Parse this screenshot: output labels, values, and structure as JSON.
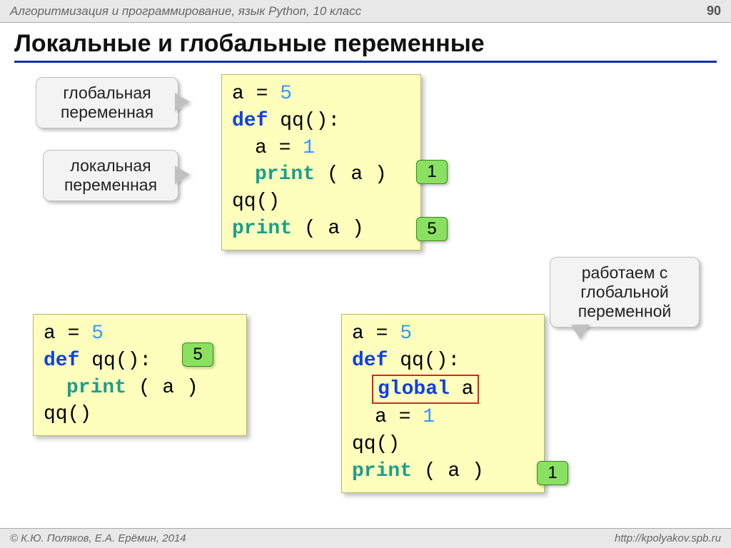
{
  "header": {
    "course": "Алгоритмизация и программирование, язык Python, 10 класс",
    "page_number": "90"
  },
  "title": "Локальные и глобальные переменные",
  "callouts": {
    "global_var": "глобальная\nпеременная",
    "local_var": "локальная\nпеременная",
    "work_with_global": "работаем с\nглобальной\nпеременной"
  },
  "code1": {
    "l1a": "a",
    "l1b": " = ",
    "l1c": "5",
    "l2a": "def",
    "l2b": " qq():",
    "l3a": "a",
    "l3b": " = ",
    "l3c": "1",
    "l4a": "print",
    "l4b": " ( a )",
    "l5": "qq()",
    "l6a": "print",
    "l6b": " ( a )"
  },
  "code2": {
    "l1a": "a",
    "l1b": " = ",
    "l1c": "5",
    "l2a": "def",
    "l2b": " qq():",
    "l3a": "print",
    "l3b": " ( a )",
    "l4": "qq()"
  },
  "code3": {
    "l1a": "a",
    "l1b": " = ",
    "l1c": "5",
    "l2a": "def",
    "l2b": " qq():",
    "l3a": "global",
    "l3b": " a",
    "l4a": "a",
    "l4b": " = ",
    "l4c": "1",
    "l5": "qq()",
    "l6a": "print",
    "l6b": " ( a )"
  },
  "badges": {
    "b1": "1",
    "b5a": "5",
    "b5b": "5",
    "b1b": "1"
  },
  "footer": {
    "copyright": "© К.Ю. Поляков, Е.А. Ерёмин, 2014",
    "url": "http://kpolyakov.spb.ru"
  }
}
